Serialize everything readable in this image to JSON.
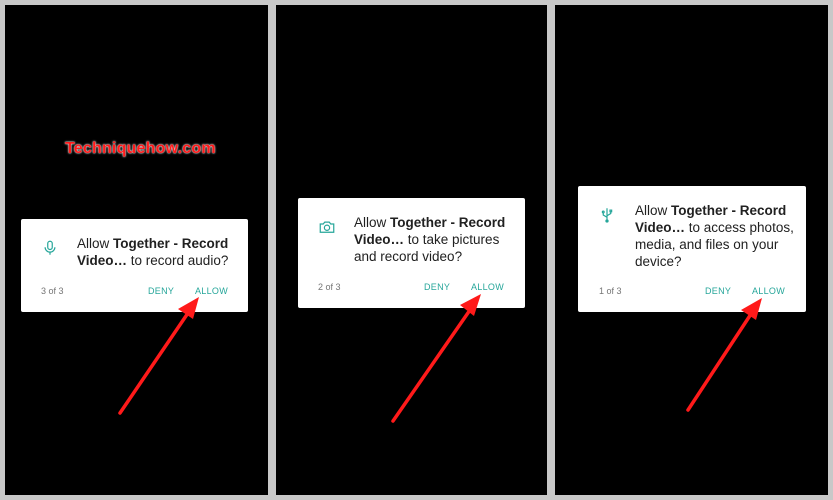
{
  "watermark": "Techniquehow.com",
  "colors": {
    "accent": "#26a69a",
    "arrow": "#ff1a1a",
    "screen_bg": "#000000",
    "frame_bg": "#c8c8c8"
  },
  "dialogs": [
    {
      "icon": "microphone-icon",
      "prefix": "Allow ",
      "app_name": "Together - Record Video…",
      "message": " to record audio?",
      "counter": "3 of 3",
      "deny_label": "DENY",
      "allow_label": "ALLOW"
    },
    {
      "icon": "camera-icon",
      "prefix": "Allow ",
      "app_name": "Together - Record Video…",
      "message": " to take pictures and record video?",
      "counter": "2 of 3",
      "deny_label": "DENY",
      "allow_label": "ALLOW"
    },
    {
      "icon": "usb-storage-icon",
      "prefix": "Allow ",
      "app_name": "Together - Record Video…",
      "message": " to access photos, media, and files on your device?",
      "counter": "1 of 3",
      "deny_label": "DENY",
      "allow_label": "ALLOW"
    }
  ]
}
